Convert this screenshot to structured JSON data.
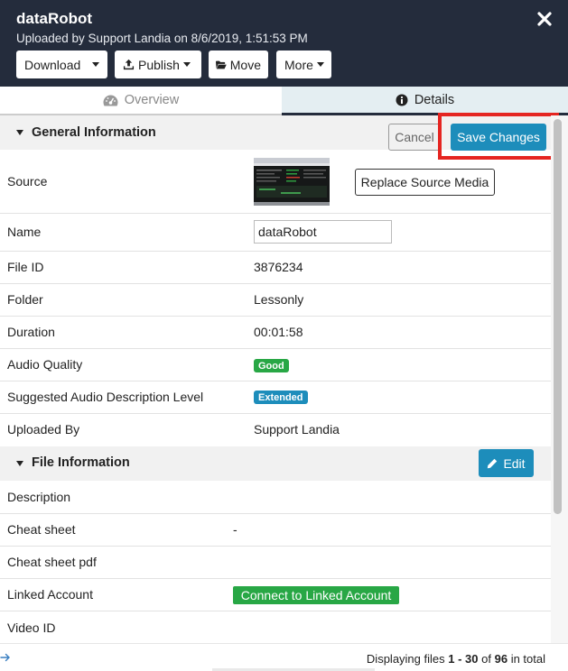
{
  "header": {
    "title": "dataRobot",
    "subtitle": "Uploaded by Support Landia on 8/6/2019, 1:51:53 PM",
    "buttons": {
      "download": "Download",
      "publish": "Publish",
      "move": "Move",
      "more": "More"
    }
  },
  "tabs": {
    "overview": "Overview",
    "details": "Details",
    "active": "Details"
  },
  "general_section": {
    "title": "General Information",
    "cancel_label": "Cancel",
    "save_label": "Save Changes",
    "replace_label": "Replace Source Media",
    "rows": [
      {
        "label": "Source"
      },
      {
        "label": "Name",
        "input_value": "dataRobot"
      },
      {
        "label": "File ID",
        "value": "3876234"
      },
      {
        "label": "Folder",
        "value": "Lessonly"
      },
      {
        "label": "Duration",
        "value": "00:01:58"
      },
      {
        "label": "Audio Quality",
        "badge": "Good"
      },
      {
        "label": "Suggested Audio Description Level",
        "badge": "Extended"
      },
      {
        "label": "Uploaded By",
        "value": "Support Landia"
      }
    ]
  },
  "file_section": {
    "title": "File Information",
    "edit_label": "Edit",
    "link_button": "Connect to Linked Account",
    "rows": [
      {
        "label": "Description",
        "value": ""
      },
      {
        "label": "Cheat sheet",
        "value": "-"
      },
      {
        "label": "Cheat sheet pdf",
        "value": ""
      },
      {
        "label": "Linked Account"
      },
      {
        "label": "Video ID",
        "value": ""
      }
    ]
  },
  "footer": {
    "prefix": "Displaying files",
    "range": "1 - 30",
    "of": "of",
    "total": "96",
    "suffix": "in total"
  },
  "colors": {
    "header_bg": "#242c3c",
    "accent": "#1d8dbb",
    "success": "#28a745",
    "highlight": "#e52521",
    "details_tab_bg": "#e4eef2"
  },
  "icons": [
    "close-icon",
    "upload-icon",
    "folder-icon",
    "dashboard-icon",
    "info-icon",
    "pencil-icon",
    "arrow-right-icon",
    "caret-down-icon"
  ]
}
